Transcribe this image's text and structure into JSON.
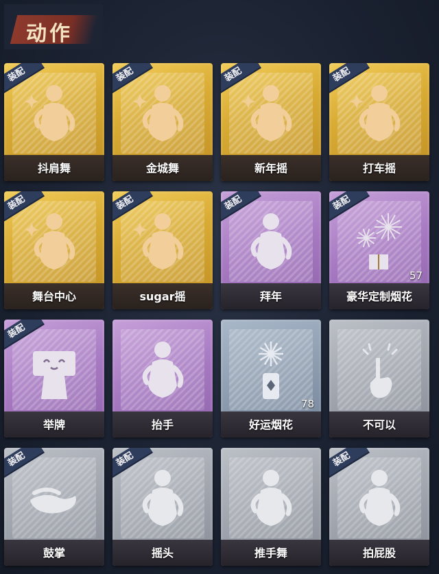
{
  "header": {
    "title": "动作"
  },
  "equip_label": "装配",
  "cards": [
    {
      "name": "抖肩舞",
      "rarity": "gold",
      "equipped": true,
      "icon": "dance-figure-icon",
      "count": ""
    },
    {
      "name": "金城舞",
      "rarity": "gold",
      "equipped": true,
      "icon": "dance-figure-icon",
      "count": ""
    },
    {
      "name": "新年摇",
      "rarity": "gold",
      "equipped": true,
      "icon": "dance-figure-icon",
      "count": ""
    },
    {
      "name": "打车摇",
      "rarity": "gold",
      "equipped": true,
      "icon": "dance-figure-icon",
      "count": ""
    },
    {
      "name": "舞台中心",
      "rarity": "gold",
      "equipped": true,
      "icon": "dance-figure-icon",
      "count": ""
    },
    {
      "name": "sugar摇",
      "rarity": "gold",
      "equipped": true,
      "icon": "dance-figure-icon",
      "count": ""
    },
    {
      "name": "拜年",
      "rarity": "purple",
      "equipped": true,
      "icon": "bow-figure-icon",
      "count": ""
    },
    {
      "name": "豪华定制烟花",
      "rarity": "purple",
      "equipped": true,
      "icon": "fireworks-box-icon",
      "count": "57"
    },
    {
      "name": "举牌",
      "rarity": "purple",
      "equipped": true,
      "icon": "sign-holder-icon",
      "count": ""
    },
    {
      "name": "抬手",
      "rarity": "purple",
      "equipped": false,
      "icon": "raise-hand-icon",
      "count": ""
    },
    {
      "name": "好运烟花",
      "rarity": "blue",
      "equipped": false,
      "icon": "firework-can-icon",
      "count": "78"
    },
    {
      "name": "不可以",
      "rarity": "gray",
      "equipped": false,
      "icon": "finger-wag-icon",
      "count": ""
    },
    {
      "name": "鼓掌",
      "rarity": "gray",
      "equipped": true,
      "icon": "clap-hands-icon",
      "count": ""
    },
    {
      "name": "摇头",
      "rarity": "gray",
      "equipped": true,
      "icon": "shake-head-icon",
      "count": ""
    },
    {
      "name": "推手舞",
      "rarity": "gray",
      "equipped": false,
      "icon": "push-dance-icon",
      "count": ""
    },
    {
      "name": "拍屁股",
      "rarity": "gray",
      "equipped": true,
      "icon": "slap-icon",
      "count": ""
    }
  ],
  "colors": {
    "gold": "#d9ac35",
    "purple": "#a679c1",
    "blue": "#8e9db0",
    "gray": "#a0a5ae",
    "badge": "#2f3d5d"
  }
}
